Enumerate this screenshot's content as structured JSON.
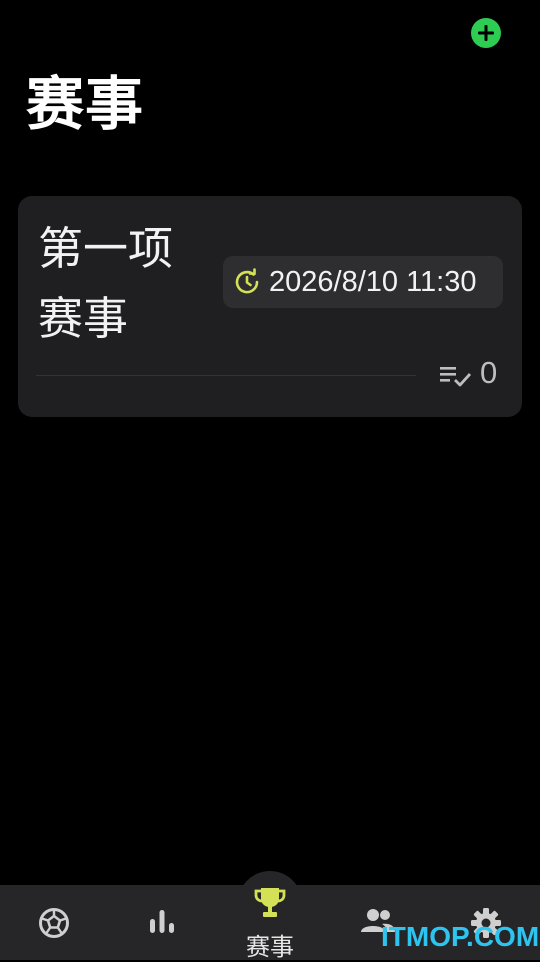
{
  "header": {
    "title": "赛事"
  },
  "event_card": {
    "name": "第一项赛事",
    "datetime": "2026/8/10 11:30",
    "checklist_count": "0"
  },
  "bottom_nav": {
    "active_label": "赛事",
    "items": [
      "football-icon",
      "stats-icon",
      "trophy-icon",
      "people-icon",
      "settings-icon"
    ]
  },
  "watermark": "ITMOP.COM",
  "colors": {
    "accent_green": "#2ecc52",
    "accent_yellow": "#d4e157",
    "card_bg": "#1f1f21",
    "nav_bg": "#262628"
  }
}
